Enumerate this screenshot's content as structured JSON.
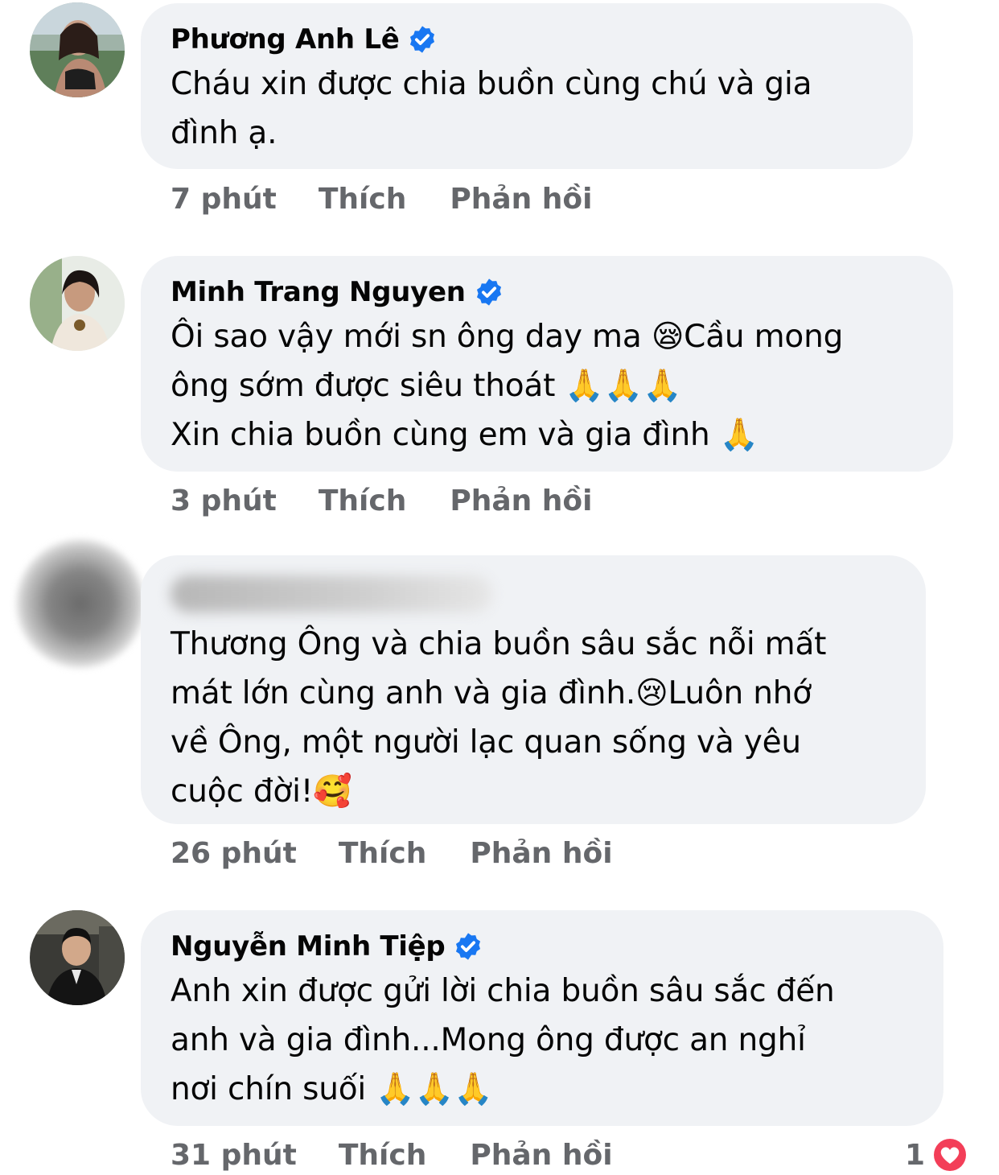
{
  "comments": [
    {
      "author": "Phương Anh Lê",
      "verified": true,
      "text": "Cháu xin được chia buồn cùng chú và gia\nđình ạ.",
      "time": "7 phút",
      "like_label": "Thích",
      "reply_label": "Phản hồi"
    },
    {
      "author": "Minh Trang Nguyen",
      "verified": true,
      "text": "Ôi sao vậy mới sn ông day ma 😪Cầu mong\nông sớm được siêu thoát 🙏🙏🙏\nXin chia buồn cùng em và gia đình 🙏",
      "time": "3 phút",
      "like_label": "Thích",
      "reply_label": "Phản hồi"
    },
    {
      "author": "",
      "verified": false,
      "text": "Thương Ông và chia buồn sâu sắc nỗi mất\nmát lớn cùng anh và gia đình.😢Luôn nhớ\nvề Ông, một người lạc quan sống và yêu\ncuộc đời!🥰",
      "time": "26 phút",
      "like_label": "Thích",
      "reply_label": "Phản hồi"
    },
    {
      "author": "Nguyễn Minh Tiệp",
      "verified": true,
      "text": "Anh xin được gửi lời chia buồn sâu sắc đến\nanh và gia đình...Mong ông được an nghỉ\nnơi chín suối 🙏🙏🙏",
      "time": "31 phút",
      "like_label": "Thích",
      "reply_label": "Phản hồi",
      "reaction_count": "1",
      "reaction_icon": "heart-icon"
    }
  ],
  "colors": {
    "bubble": "#f0f2f5",
    "verified": "#1877f2",
    "meta_text": "#65676b",
    "heart": "#f33e58"
  }
}
